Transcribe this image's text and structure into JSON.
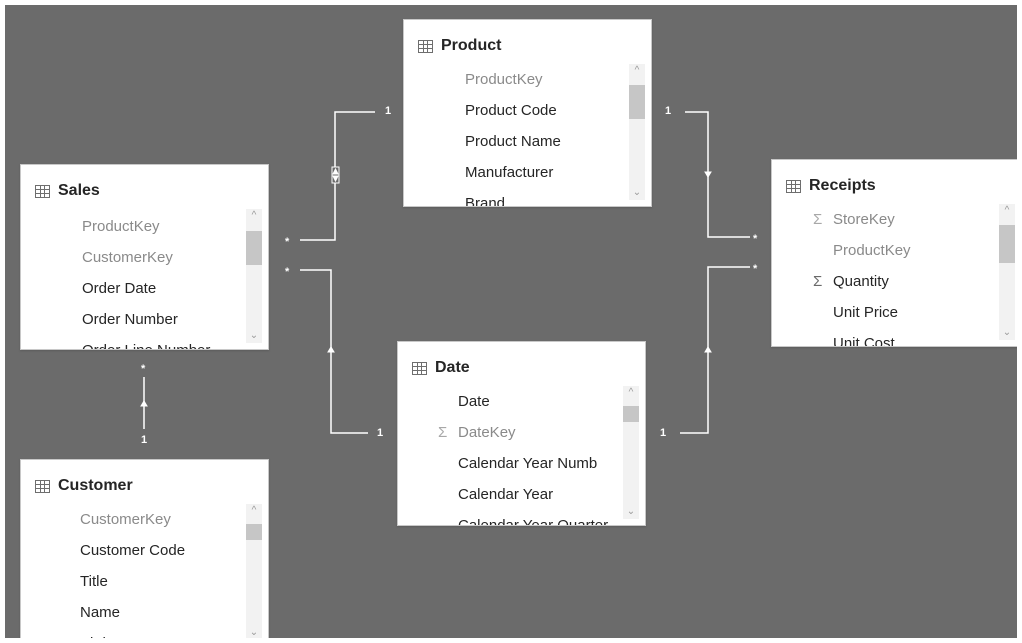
{
  "tables": {
    "product": {
      "title": "Product",
      "fields": [
        "ProductKey",
        "Product Code",
        "Product Name",
        "Manufacturer",
        "Brand"
      ]
    },
    "sales": {
      "title": "Sales",
      "fields": [
        "ProductKey",
        "CustomerKey",
        "Order Date",
        "Order Number",
        "Order Line Number"
      ]
    },
    "receipts": {
      "title": "Receipts",
      "fields": [
        "StoreKey",
        "ProductKey",
        "Quantity",
        "Unit Price",
        "Unit Cost"
      ]
    },
    "date": {
      "title": "Date",
      "fields": [
        "Date",
        "DateKey",
        "Calendar Year Numb",
        "Calendar Year",
        "Calendar Year Quarter"
      ]
    },
    "customer": {
      "title": "Customer",
      "fields": [
        "CustomerKey",
        "Customer Code",
        "Title",
        "Name",
        "Birth Date"
      ]
    }
  },
  "relationships": {
    "product_sales": {
      "one": "1",
      "many": "*"
    },
    "product_receipts": {
      "one": "1",
      "many": "*"
    },
    "date_sales": {
      "one": "1",
      "many": "*"
    },
    "date_receipts": {
      "one": "1",
      "many": "*"
    },
    "customer_sales": {
      "one": "1",
      "many": "*"
    }
  },
  "icons": {
    "table": "table-grid-icon",
    "sigma": "sigma-icon",
    "scroll_up": "chevron-up-icon",
    "scroll_down": "chevron-down-icon"
  },
  "glyphs": {
    "sigma": "Σ",
    "up": "^",
    "down": "⌄"
  },
  "colors": {
    "canvas": "#6b6b6b",
    "card": "#ffffff",
    "connector": "#ffffff",
    "thumb": "#c6c6c6"
  }
}
